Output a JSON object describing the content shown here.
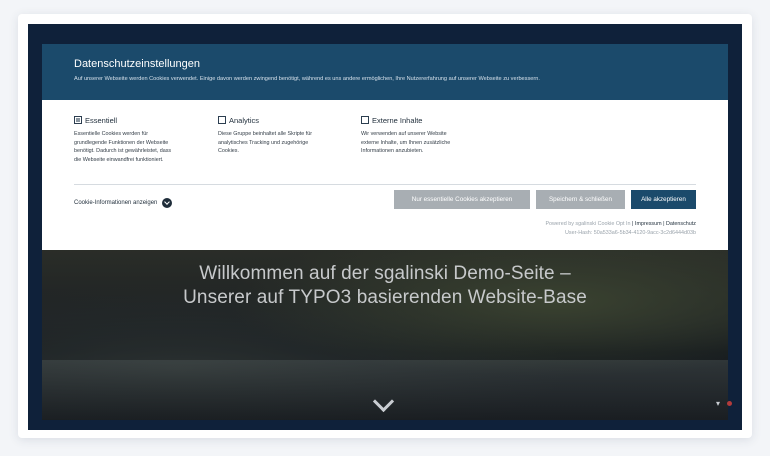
{
  "hero": {
    "title_line1": "Willkommen auf der sgalinski Demo-Seite –",
    "title_line2": "Unserer auf TYPO3 basierenden Website-Base"
  },
  "modal": {
    "title": "Datenschutzeinstellungen",
    "description": "Auf unserer Webseite werden Cookies verwendet. Einige davon werden zwingend benötigt, während es uns andere ermöglichen, Ihre Nutzererfahrung auf unserer Webseite zu verbessern.",
    "groups": [
      {
        "label": "Essentiell",
        "checked": true,
        "lines": [
          "Essentielle Cookies werden für",
          "grundlegende Funktionen der Webseite",
          "benötigt. Dadurch ist gewährleistet, dass",
          "die Webseite einwandfrei funktioniert."
        ]
      },
      {
        "label": "Analytics",
        "checked": false,
        "lines": [
          "Diese Gruppe beinhaltet alle Skripte für",
          "analytisches Tracking und zugehörige",
          "Cookies."
        ]
      },
      {
        "label": "Externe Inhalte",
        "checked": false,
        "lines": [
          "Wir verwenden auf unserer Website",
          "externe Inhalte, um Ihnen zusätzliche",
          "Informationen anzubieten."
        ]
      }
    ],
    "info_link": "Cookie-Informationen anzeigen",
    "buttons": {
      "essential_only": "Nur essentielle Cookies akzeptieren",
      "save_close": "Speichern & schließen",
      "accept_all": "Alle akzeptieren"
    },
    "powered_by": "Powered by sgalinski Cookie Opt In",
    "separator": "|",
    "imprint": "Impressum",
    "privacy": "Datenschutz",
    "user_hash": "User-Hash: 50a533a6-5b34-4120-9acc-3c2d6444d03b"
  },
  "colors": {
    "primary": "#1b4a6b",
    "button_gray": "#a8aeb3",
    "page_background": "#0f213a"
  }
}
